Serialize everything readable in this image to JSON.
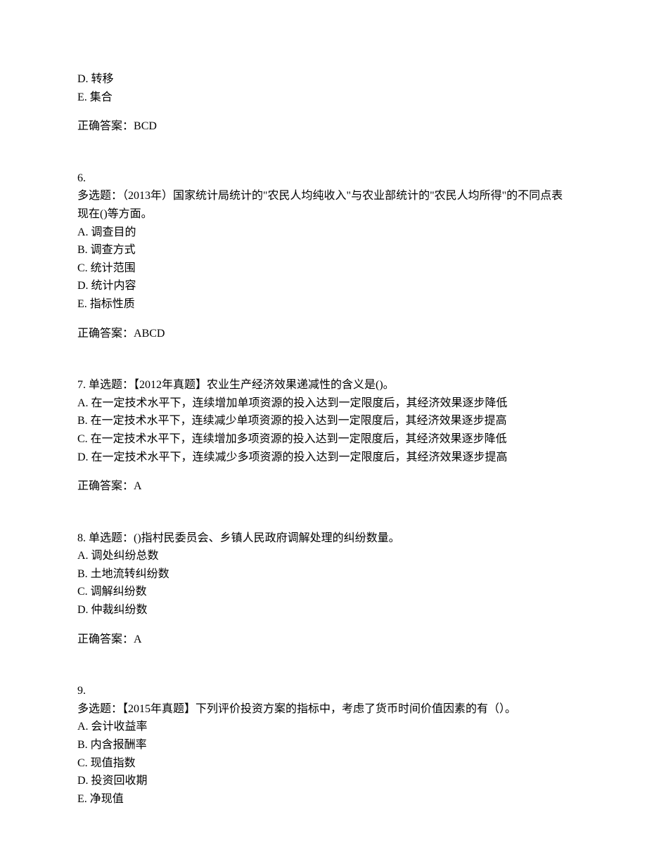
{
  "q5_tail": {
    "optD": "D. 转移",
    "optE": "E. 集合",
    "answer_label": "正确答案：",
    "answer": "BCD"
  },
  "q6": {
    "number": "6.",
    "type": "多选题：",
    "stem": "（2013年）国家统计局统计的\"农民人均纯收入\"与农业部统计的\"农民人均所得\"的不同点表现在()等方面。",
    "optA": "A. 调查目的",
    "optB": "B. 调查方式",
    "optC": "C. 统计范围",
    "optD": "D. 统计内容",
    "optE": "E. 指标性质",
    "answer_label": "正确答案：",
    "answer": "ABCD"
  },
  "q7": {
    "header": "7.  单选题：【2012年真题】农业生产经济效果递减性的含义是()。",
    "optA": "A. 在一定技术水平下，连续增加单项资源的投入达到一定限度后，其经济效果逐步降低",
    "optB": "B. 在一定技术水平下，连续减少单项资源的投入达到一定限度后，其经济效果逐步提高",
    "optC": "C. 在一定技术水平下，连续增加多项资源的投入达到一定限度后，其经济效果逐步降低",
    "optD": "D. 在一定技术水平下，连续减少多项资源的投入达到一定限度后，其经济效果逐步提高",
    "answer_label": "正确答案：",
    "answer": "A"
  },
  "q8": {
    "header": "8.  单选题：()指村民委员会、乡镇人民政府调解处理的纠纷数量。",
    "optA": "A. 调处纠纷总数",
    "optB": "B. 土地流转纠纷数",
    "optC": "C. 调解纠纷数",
    "optD": "D. 仲裁纠纷数",
    "answer_label": "正确答案：",
    "answer": "A"
  },
  "q9": {
    "number": "9.",
    "type": "多选题：",
    "stem": "【2015年真题】下列评价投资方案的指标中，考虑了货币时间价值因素的有（）。",
    "optA": "A. 会计收益率",
    "optB": "B. 内含报酬率",
    "optC": "C. 现值指数",
    "optD": "D. 投资回收期",
    "optE": "E. 净现值"
  }
}
